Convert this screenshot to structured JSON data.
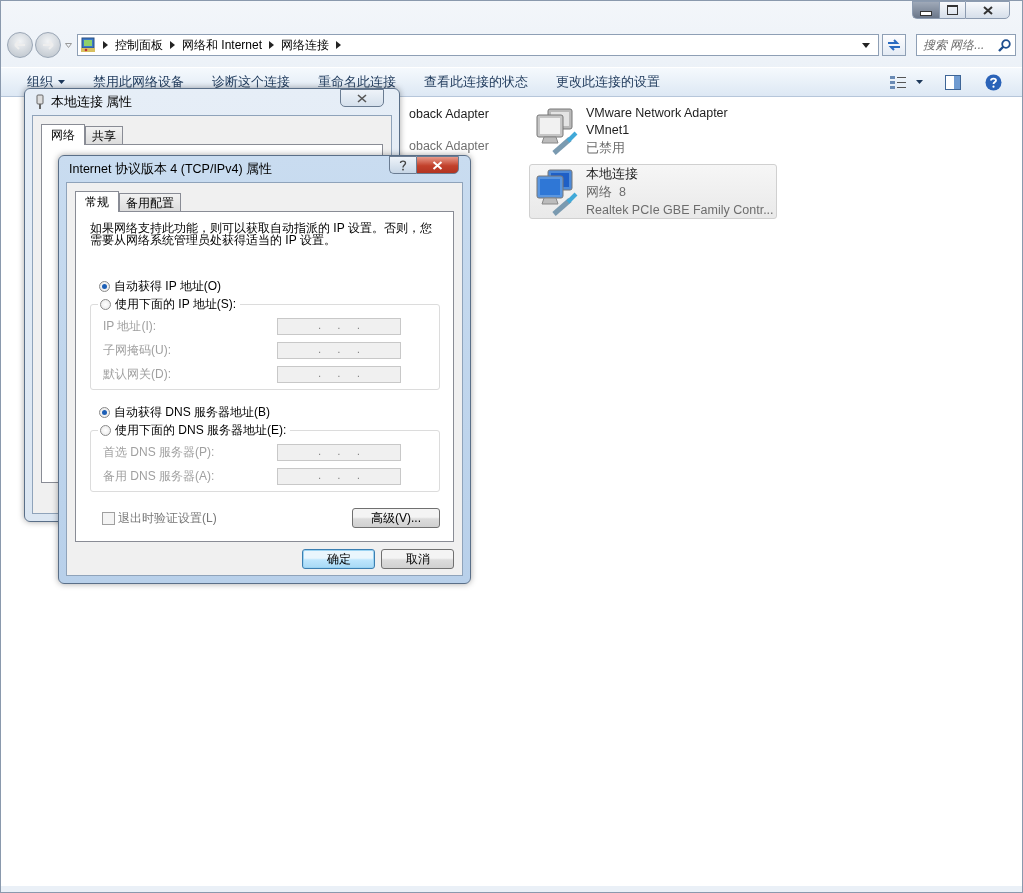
{
  "address_bar": {
    "path": [
      "控制面板",
      "网络和 Internet",
      "网络连接"
    ]
  },
  "search": {
    "placeholder": "搜索 网络..."
  },
  "toolbar": {
    "items": [
      {
        "label": "组织",
        "has_menu": true
      },
      {
        "label": "禁用此网络设备",
        "has_menu": false
      },
      {
        "label": "诊断这个连接",
        "has_menu": false
      },
      {
        "label": "重命名此连接",
        "has_menu": false
      },
      {
        "label": "查看此连接的状态",
        "has_menu": false
      },
      {
        "label": "更改此连接的设置",
        "has_menu": false
      }
    ]
  },
  "partial_adapters": [
    {
      "name": "oback Adapter",
      "disabled": false
    },
    {
      "name": "oback Adapter",
      "disabled": true
    }
  ],
  "adapters": [
    {
      "name": "VMware Network Adapter VMnet1",
      "status": "已禁用",
      "disabled": true,
      "selected": false
    },
    {
      "name": "本地连接",
      "status": "网络  8",
      "device": "Realtek PCIe GBE Family Contr...",
      "disabled": false,
      "selected": true
    }
  ],
  "properties_dialog": {
    "title": "本地连接 属性",
    "tabs": [
      {
        "label": "网络",
        "selected": true
      },
      {
        "label": "共享",
        "selected": false
      }
    ]
  },
  "ipv4_dialog": {
    "title": "Internet 协议版本 4 (TCP/IPv4) 属性",
    "tabs": [
      {
        "label": "常规",
        "selected": true
      },
      {
        "label": "备用配置",
        "selected": false
      }
    ],
    "description": "如果网络支持此功能，则可以获取自动指派的 IP 设置。否则，您需要从网络系统管理员处获得适当的 IP 设置。",
    "ip_options": [
      {
        "label": "自动获得 IP 地址(O)",
        "selected": true
      },
      {
        "label": "使用下面的 IP 地址(S):",
        "selected": false
      }
    ],
    "ip_fields": [
      {
        "label": "IP 地址(I):",
        "value": ".      .      .",
        "disabled": true
      },
      {
        "label": "子网掩码(U):",
        "value": ".      .      .",
        "disabled": true
      },
      {
        "label": "默认网关(D):",
        "value": ".      .      .",
        "disabled": true
      }
    ],
    "dns_options": [
      {
        "label": "自动获得 DNS 服务器地址(B)",
        "selected": true
      },
      {
        "label": "使用下面的 DNS 服务器地址(E):",
        "selected": false
      }
    ],
    "dns_fields": [
      {
        "label": "首选 DNS 服务器(P):",
        "value": ".      .      .",
        "disabled": true
      },
      {
        "label": "备用 DNS 服务器(A):",
        "value": ".      .      .",
        "disabled": true
      }
    ],
    "validate_on_exit": {
      "label": "退出时验证设置(L)",
      "checked": false,
      "disabled": true
    },
    "advanced_button": "高级(V)...",
    "buttons": [
      {
        "label": "确定",
        "default": true
      },
      {
        "label": "取消",
        "default": false
      }
    ]
  }
}
